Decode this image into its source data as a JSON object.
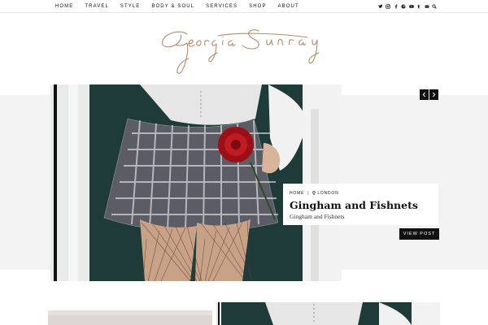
{
  "nav": {
    "items": [
      {
        "label": "HOME"
      },
      {
        "label": "TRAVEL"
      },
      {
        "label": "STYLE"
      },
      {
        "label": "BODY & SOUL"
      },
      {
        "label": "SERVICES"
      },
      {
        "label": "SHOP"
      },
      {
        "label": "ABOUT"
      }
    ],
    "social_icons": [
      "twitter-icon",
      "instagram-icon",
      "facebook-icon",
      "pinterest-icon",
      "youtube-icon",
      "tumblr-icon",
      "email-icon",
      "search-icon"
    ]
  },
  "logo": {
    "text": "Georgia Sunray",
    "color": "#b48a6e"
  },
  "hero": {
    "category": "HOME",
    "location": "LONDON",
    "title": "Gingham and Fishnets",
    "excerpt": "Gingham and Fishnets",
    "button_label": "VIEW POST"
  },
  "colors": {
    "accent": "#111111",
    "band": "#f3f3f3",
    "rose": "#b3121b"
  }
}
